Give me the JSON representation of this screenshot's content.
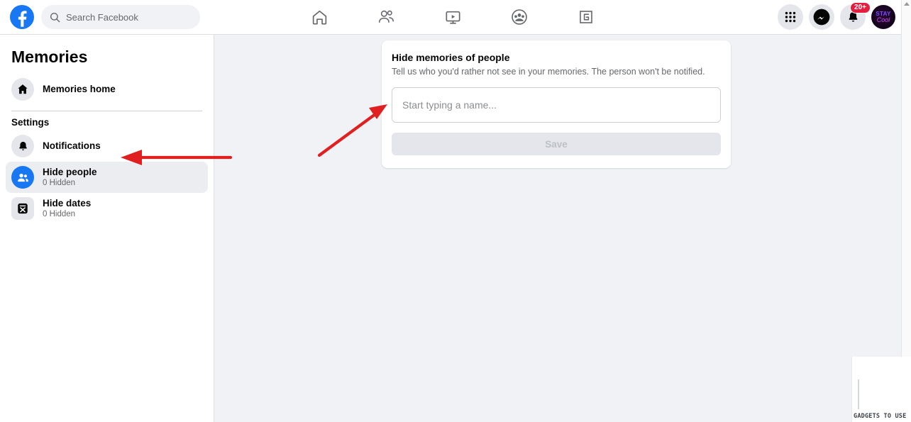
{
  "topbar": {
    "logo_icon": "facebook-logo-icon",
    "search": {
      "placeholder": "Search Facebook",
      "icon": "search-icon"
    },
    "nav": [
      {
        "name": "home",
        "icon": "home-icon"
      },
      {
        "name": "friends",
        "icon": "friends-icon"
      },
      {
        "name": "watch",
        "icon": "watch-video-icon"
      },
      {
        "name": "groups",
        "icon": "groups-icon"
      },
      {
        "name": "gaming",
        "icon": "gaming-icon"
      }
    ],
    "right": {
      "menu_icon": "grid-menu-icon",
      "messenger_icon": "messenger-icon",
      "notifications_icon": "bell-icon",
      "notifications_badge": "20+",
      "avatar_line1": "STAY",
      "avatar_line2": "Cool"
    }
  },
  "sidebar": {
    "title": "Memories",
    "home_item": {
      "label": "Memories home",
      "icon": "home-filled-icon"
    },
    "section_label": "Settings",
    "items": [
      {
        "label": "Notifications",
        "sub": "",
        "icon": "bell-filled-icon",
        "active": false
      },
      {
        "label": "Hide people",
        "sub": "0 Hidden",
        "icon": "people-filled-icon",
        "active": true
      },
      {
        "label": "Hide dates",
        "sub": "0 Hidden",
        "icon": "calendar-x-icon",
        "active": false
      }
    ]
  },
  "card": {
    "title": "Hide memories of people",
    "subtitle": "Tell us who you'd rather not see in your memories. The person won't be notified.",
    "input_placeholder": "Start typing a name...",
    "input_value": "",
    "save_label": "Save"
  },
  "annotations": {
    "arrow_color": "#e02020",
    "arrow_to_input": "diagonal-arrow-pointing-to-name-input",
    "arrow_to_hide_people": "horizontal-arrow-pointing-to-hide-people"
  },
  "watermark": {
    "text": "GADGETS TO USE"
  },
  "colors": {
    "brand_blue": "#1877f2",
    "page_bg": "#f0f2f5",
    "card_bg": "#ffffff",
    "badge_red": "#e41e3f",
    "arrow_red": "#e02020"
  }
}
